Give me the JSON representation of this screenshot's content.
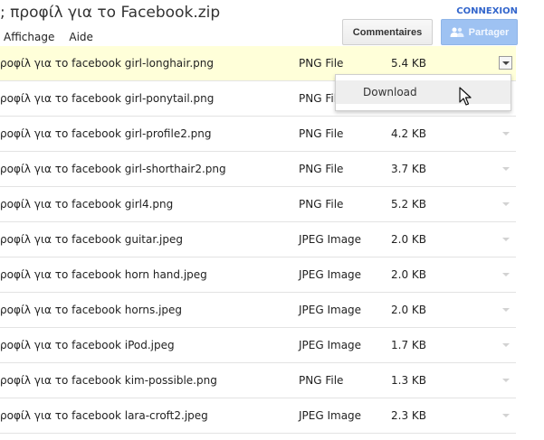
{
  "header": {
    "title": "; προφίλ για το Facebook.zip",
    "connexion": "CONNEXION",
    "comments_button": "Commentaires",
    "share_button": "Partager"
  },
  "menubar": {
    "items": [
      "Affichage",
      "Aide"
    ]
  },
  "files": [
    {
      "name": "ροφίλ για το facebook girl-longhair.png",
      "type": "PNG File",
      "size": "5.4  KB"
    },
    {
      "name": "ροφίλ για το facebook girl-ponytail.png",
      "type": "PNG File",
      "size": ""
    },
    {
      "name": "ροφίλ για το facebook girl-profile2.png",
      "type": "PNG File",
      "size": "4.2  KB"
    },
    {
      "name": "ροφίλ για το facebook girl-shorthair2.png",
      "type": "PNG File",
      "size": "3.7  KB"
    },
    {
      "name": "ροφίλ για το facebook girl4.png",
      "type": "PNG File",
      "size": "5.2  KB"
    },
    {
      "name": "ροφίλ για το facebook guitar.jpeg",
      "type": "JPEG Image",
      "size": "2.0  KB"
    },
    {
      "name": "ροφίλ για το facebook horn hand.jpeg",
      "type": "JPEG Image",
      "size": "2.0  KB"
    },
    {
      "name": "ροφίλ για το facebook horns.jpeg",
      "type": "JPEG Image",
      "size": "2.0  KB"
    },
    {
      "name": "ροφίλ για το facebook iPod.jpeg",
      "type": "JPEG Image",
      "size": "1.7  KB"
    },
    {
      "name": "ροφίλ για το facebook kim-possible.png",
      "type": "PNG File",
      "size": "1.3  KB"
    },
    {
      "name": "ροφίλ για το facebook lara-croft2.jpeg",
      "type": "JPEG Image",
      "size": "2.3  KB"
    }
  ],
  "context_menu": {
    "download": "Download"
  },
  "icons": {
    "share": "people-icon",
    "dropdown": "chevron-down-icon",
    "cursor": "mouse-pointer-icon"
  },
  "colors": {
    "accent": "#3366cc",
    "active_row": "#ffffd9",
    "share_button": "#9ec2f2"
  }
}
